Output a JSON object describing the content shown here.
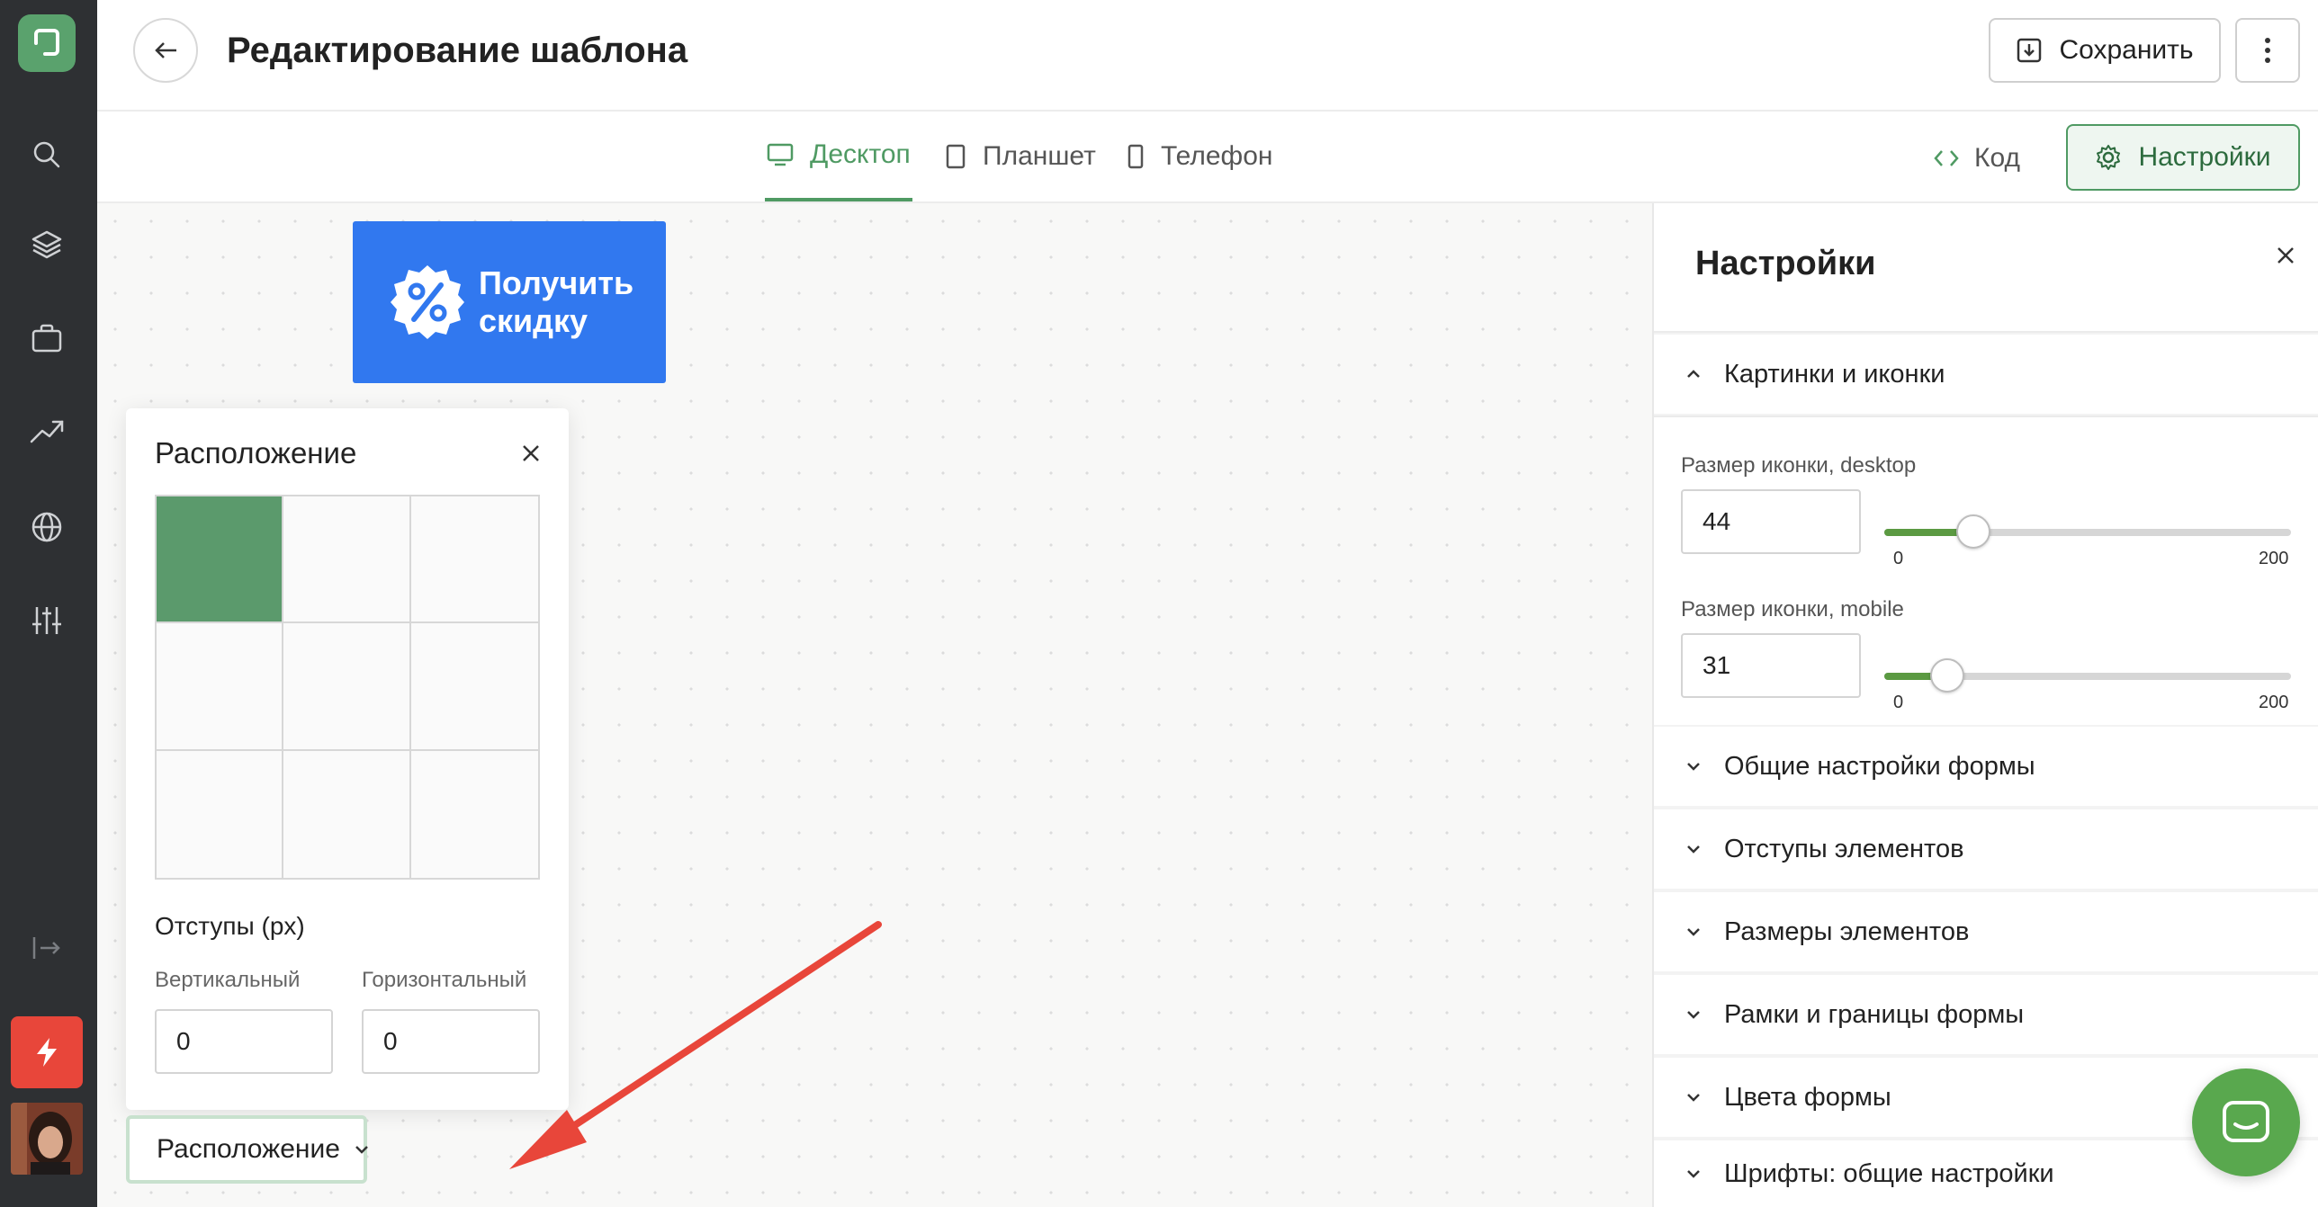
{
  "header": {
    "title": "Редактирование шаблона",
    "save_label": "Сохранить"
  },
  "toolbar": {
    "tabs": [
      {
        "label": "Десктоп",
        "icon": "monitor-icon",
        "active": true
      },
      {
        "label": "Планшет",
        "icon": "tablet-icon",
        "active": false
      },
      {
        "label": "Телефон",
        "icon": "phone-icon",
        "active": false
      }
    ],
    "code_label": "Код",
    "settings_label": "Настройки"
  },
  "canvas": {
    "discount_button": {
      "line1": "Получить",
      "line2": "скидку",
      "icon": "percent-badge-icon",
      "color": "#3178ef"
    },
    "placement_popover": {
      "title": "Расположение",
      "selected_cell": "top-left",
      "margins_title": "Отступы (px)",
      "vertical_label": "Вертикальный",
      "vertical_value": "0",
      "horizontal_label": "Горизонтальный",
      "horizontal_value": "0"
    },
    "placement_dropdown_label": "Расположение"
  },
  "settings": {
    "title": "Настройки",
    "sections": [
      {
        "label": "Картинки и иконки",
        "expanded": true
      },
      {
        "label": "Общие настройки формы",
        "expanded": false
      },
      {
        "label": "Отступы элементов",
        "expanded": false
      },
      {
        "label": "Размеры элементов",
        "expanded": false
      },
      {
        "label": "Рамки и границы формы",
        "expanded": false
      },
      {
        "label": "Цвета формы",
        "expanded": false
      },
      {
        "label": "Шрифты: общие настройки",
        "expanded": false
      }
    ],
    "icon_size_desktop": {
      "label": "Размер иконки, desktop",
      "value": "44",
      "min": "0",
      "max": "200"
    },
    "icon_size_mobile": {
      "label": "Размер иконки, mobile",
      "value": "31",
      "min": "0",
      "max": "200"
    }
  },
  "colors": {
    "accent": "#4f9a63",
    "selected_cell": "#5b9a6c",
    "rail": "#2e3033",
    "annotation_arrow": "#e8463a",
    "chat_widget": "#59a84e"
  }
}
